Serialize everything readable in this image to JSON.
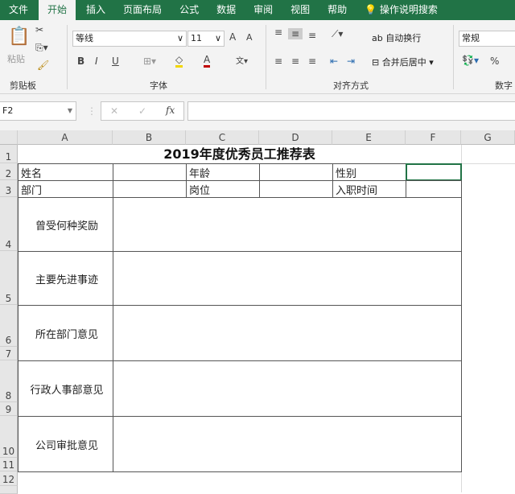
{
  "tabs": [
    "文件",
    "开始",
    "插入",
    "页面布局",
    "公式",
    "数据",
    "审阅",
    "视图",
    "帮助"
  ],
  "tell_me": "操作说明搜索",
  "clipboard": {
    "paste": "粘贴",
    "group": "剪贴板"
  },
  "font": {
    "name": "等线",
    "size": "11",
    "group": "字体",
    "bold": "B",
    "italic": "I",
    "underline": "U",
    "grow": "A",
    "shrink": "A",
    "color_a": "A"
  },
  "alignment": {
    "wrap": "自动换行",
    "merge": "合并后居中",
    "group": "对齐方式"
  },
  "number": {
    "format": "常规",
    "percent": "%",
    "group": "数字"
  },
  "formula_bar": {
    "name_box": "F2",
    "fx": "fx",
    "value": ""
  },
  "columns": [
    "A",
    "B",
    "C",
    "D",
    "E",
    "F",
    "G"
  ],
  "rows": [
    "1",
    "2",
    "3",
    "4",
    "5",
    "6",
    "7",
    "8",
    "9",
    "10",
    "11",
    "12"
  ],
  "sheet": {
    "title": "2019年度优秀员工推荐表",
    "name_label": "姓名",
    "age_label": "年龄",
    "gender_label": "性别",
    "dept_label": "部门",
    "position_label": "岗位",
    "hire_label": "入职时间",
    "awards": "曾受何种奖励",
    "deeds": "主要先进事迹",
    "dept_opinion": "所在部门意见",
    "hr_opinion": "行政人事部意见",
    "company_opinion": "公司审批意见"
  },
  "colors": {
    "brand": "#217346"
  }
}
